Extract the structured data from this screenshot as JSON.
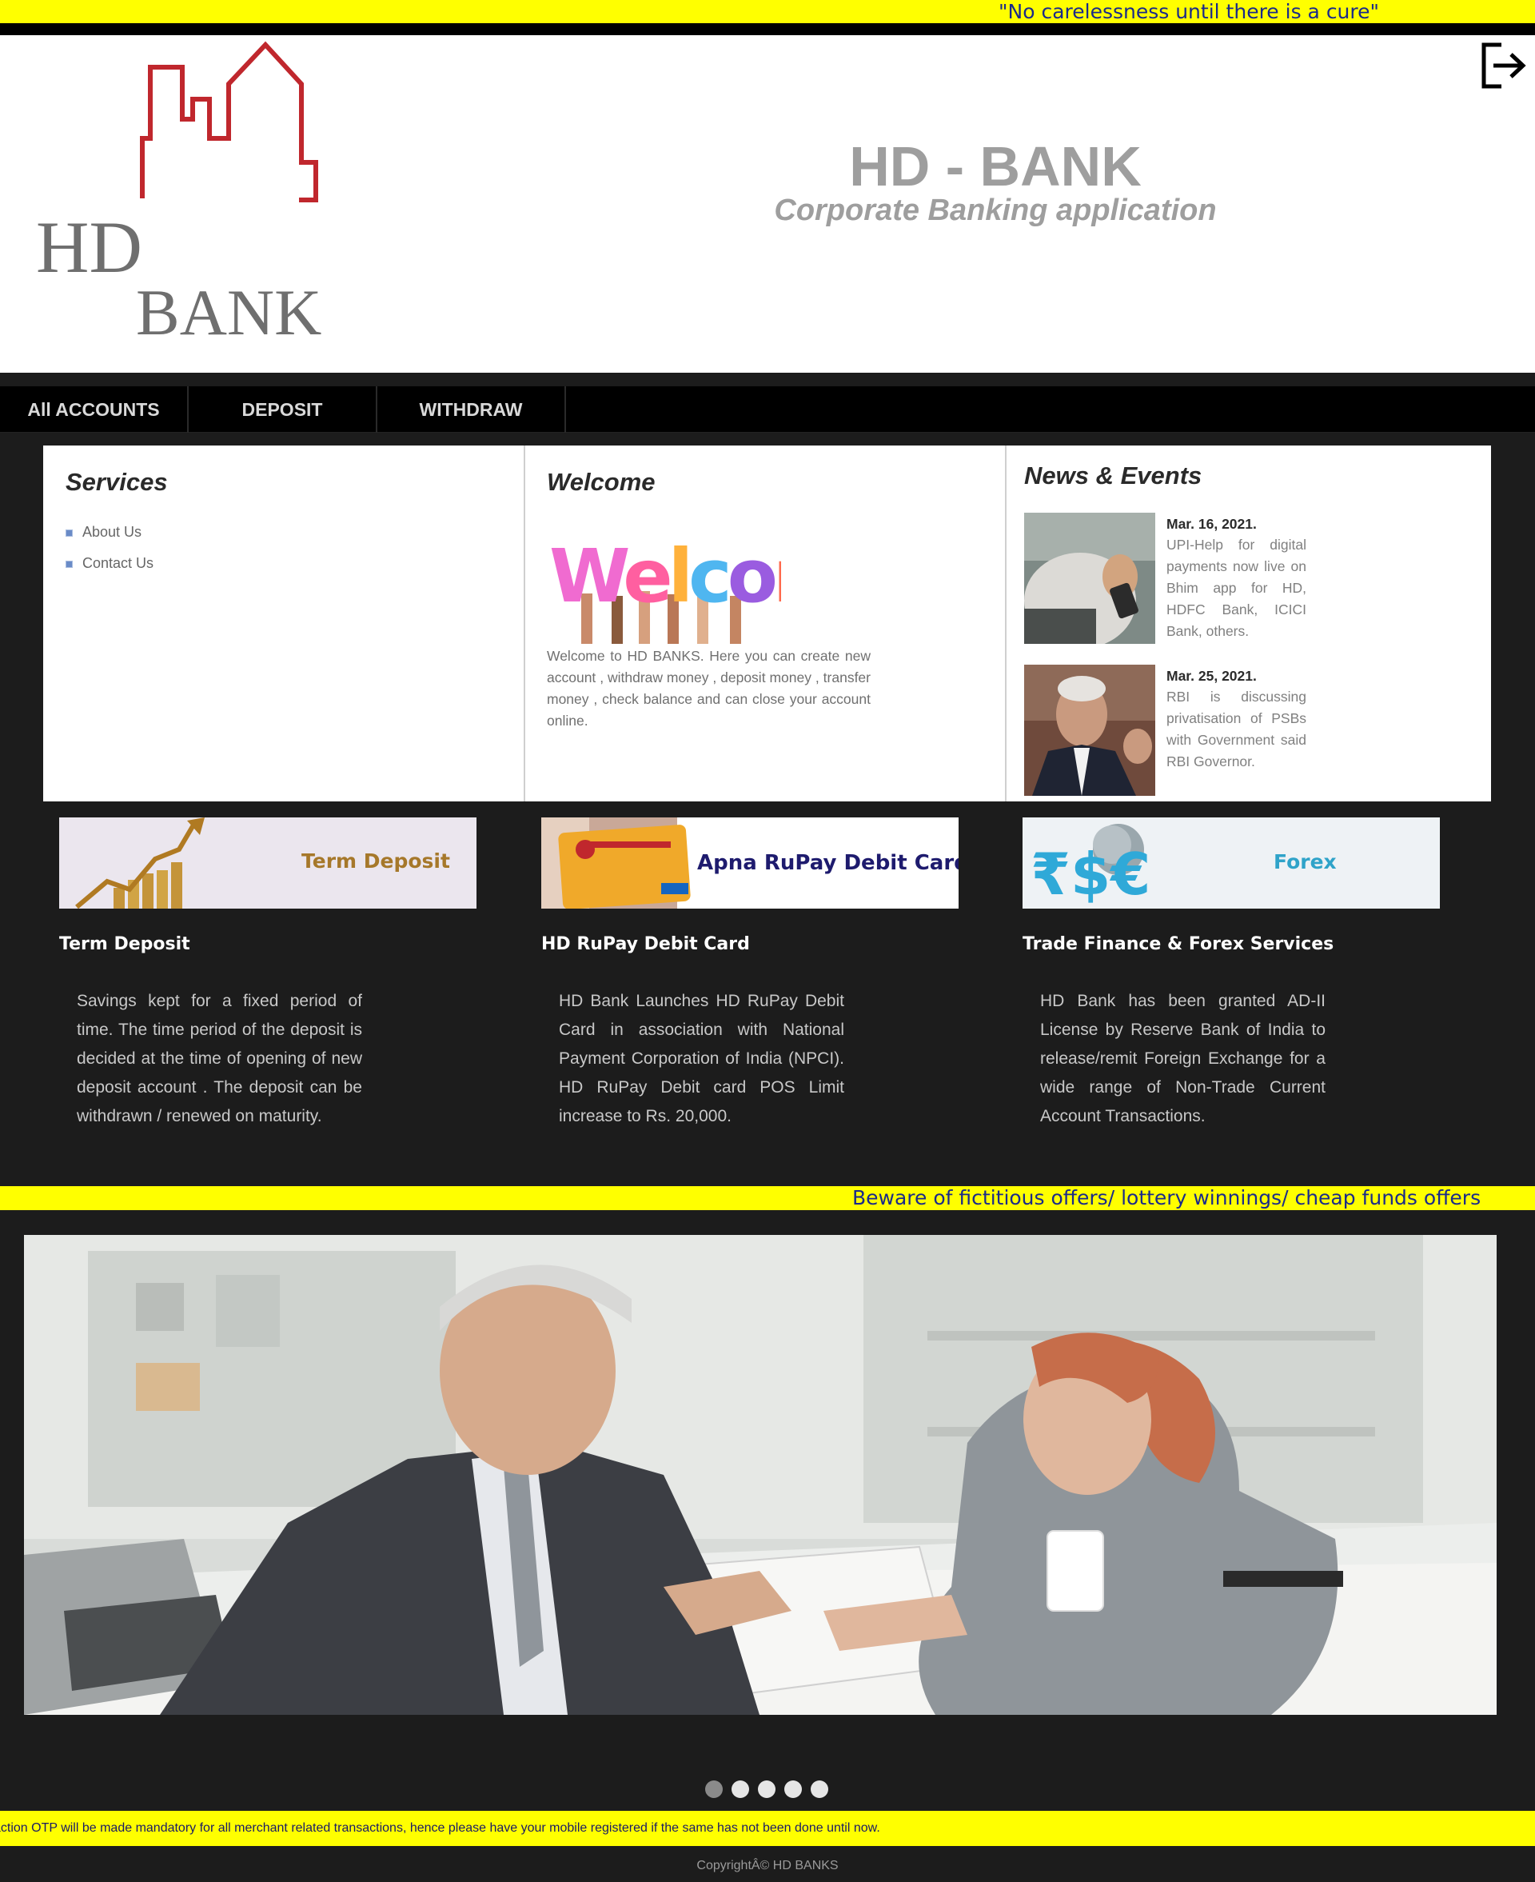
{
  "tickers": {
    "top": "\"No carelessness until there is a cure\"",
    "middle": "Beware of fictitious offers/ lottery winnings/ cheap funds offers",
    "bottom": "action OTP will be made mandatory for all merchant related transactions, hence please have your mobile registered if the same has not been done until now."
  },
  "header": {
    "logo_line1": "HD",
    "logo_line2": "BANK",
    "title": "HD - BANK",
    "subtitle": "Corporate Banking application",
    "logout_icon": "logout-icon"
  },
  "nav": {
    "items": [
      {
        "label": "All ACCOUNTS"
      },
      {
        "label": "DEPOSIT"
      },
      {
        "label": "WITHDRAW"
      }
    ]
  },
  "services": {
    "heading": "Services",
    "items": [
      {
        "label": "About Us"
      },
      {
        "label": "Contact Us"
      }
    ]
  },
  "welcome": {
    "heading": "Welcome",
    "image_text": "Welcome",
    "text": "Welcome to HD BANKS. Here you can create new account , withdraw money , deposit money , transfer money , check balance and can close your account online."
  },
  "news": {
    "heading": "News & Events",
    "items": [
      {
        "date": "Mar. 16, 2021.",
        "text": "UPI-Help for digital payments now live on Bhim app for HD, HDFC Bank, ICICI Bank, others."
      },
      {
        "date": "Mar. 25, 2021.",
        "text": "RBI is discussing privatisation of PSBs with Government said RBI Governor."
      }
    ]
  },
  "cards": [
    {
      "banner_text": "Term Deposit",
      "title": "Term Deposit",
      "text": "Savings kept for a fixed period of time. The time period of the deposit is decided at the time of opening of new deposit account . The deposit can be withdrawn / renewed on maturity."
    },
    {
      "banner_text": "Apna RuPay Debit Card",
      "title": "HD RuPay Debit Card",
      "text": "HD Bank Launches HD RuPay Debit Card in association with National Payment Corporation of India (NPCI). HD RuPay Debit card POS Limit increase to Rs. 20,000."
    },
    {
      "banner_text": "Forex",
      "title": "Trade Finance & Forex Services",
      "text": "HD Bank has been granted AD-II License by Reserve Bank of India to release/remit Foreign Exchange for a wide range of Non-Trade Current Account Transactions."
    }
  ],
  "slider": {
    "active_index": 0,
    "count": 5
  },
  "footer": {
    "text": "CopyrightÂ© HD BANKS"
  },
  "colors": {
    "ticker_bg": "#ffff00",
    "ticker_text": "#1a2a8a",
    "page_bg": "#1c1c1c",
    "logo_red": "#c0272d"
  }
}
